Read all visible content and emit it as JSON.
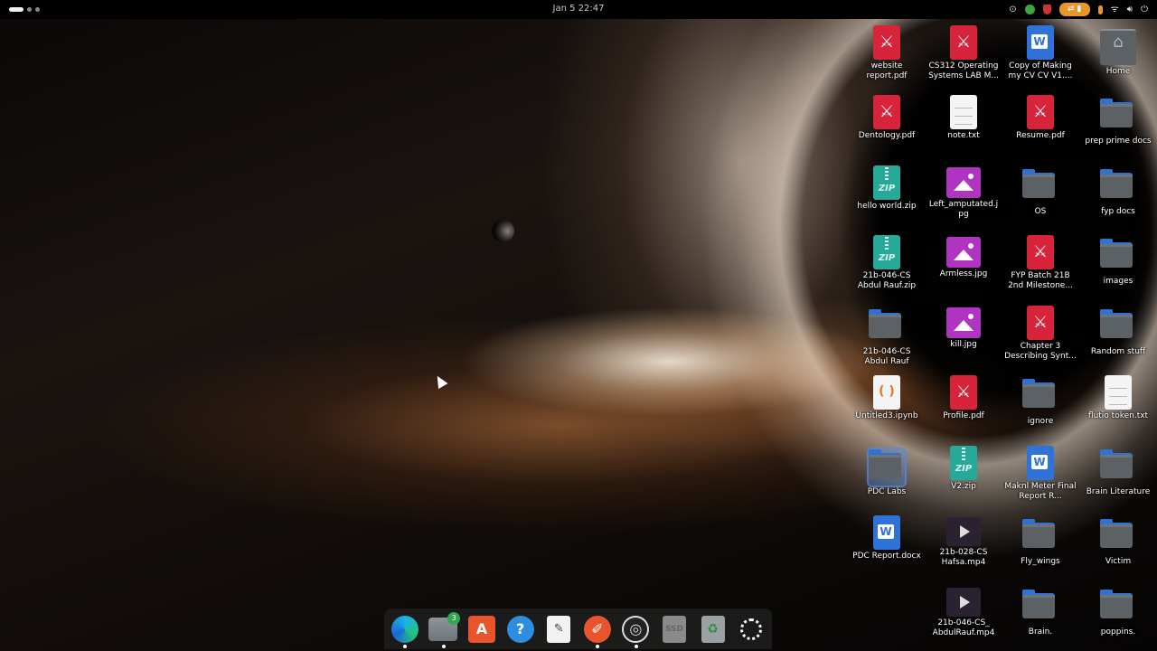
{
  "topbar": {
    "datetime": "Jan 5  22:47",
    "tray_orange_label": "⇄ ▮"
  },
  "colors": {
    "accent": "#e8962a",
    "folder_blue": "#2e72d2",
    "selected": "#508ce6"
  },
  "desktop": {
    "icons": [
      {
        "label": "website report.pdf",
        "type": "pdf"
      },
      {
        "label": "CS312 Operating Systems LAB M...",
        "type": "pdf"
      },
      {
        "label": "Copy of Making my CV  CV V1....",
        "type": "doc"
      },
      {
        "label": "Home",
        "type": "home"
      },
      {
        "label": "Dentology.pdf",
        "type": "pdf"
      },
      {
        "label": "note.txt",
        "type": "txt"
      },
      {
        "label": "Resume.pdf",
        "type": "pdf"
      },
      {
        "label": "prep prime docs",
        "type": "folder"
      },
      {
        "label": "hello world.zip",
        "type": "zip"
      },
      {
        "label": "Left_amputated.jpg",
        "type": "img"
      },
      {
        "label": "OS",
        "type": "folder"
      },
      {
        "label": "fyp docs",
        "type": "folder"
      },
      {
        "label": "21b-046-CS Abdul Rauf.zip",
        "type": "zip"
      },
      {
        "label": "Armless.jpg",
        "type": "img"
      },
      {
        "label": "FYP Batch 21B 2nd Milestone...",
        "type": "pdf"
      },
      {
        "label": "images",
        "type": "folder"
      },
      {
        "label": "21b-046-CS Abdul Rauf",
        "type": "folder"
      },
      {
        "label": "kill.jpg",
        "type": "img"
      },
      {
        "label": "Chapter 3 Describing Synt...",
        "type": "pdf"
      },
      {
        "label": "Random stuff",
        "type": "folder"
      },
      {
        "label": "Untitled3.ipynb",
        "type": "ipynb"
      },
      {
        "label": "Profile.pdf",
        "type": "pdf"
      },
      {
        "label": "ignore",
        "type": "folder"
      },
      {
        "label": "flutio token.txt",
        "type": "txt"
      },
      {
        "label": "PDC Labs",
        "type": "folder",
        "selected": true
      },
      {
        "label": "V2.zip",
        "type": "zip"
      },
      {
        "label": "Maknl Meter Final Report R...",
        "type": "doc"
      },
      {
        "label": "Brain Literature",
        "type": "folder"
      },
      {
        "label": "PDC Report.docx",
        "type": "doc"
      },
      {
        "label": "21b-028-CS Hafsa.mp4",
        "type": "video"
      },
      {
        "label": "Fly_wings",
        "type": "folder"
      },
      {
        "label": "Victim",
        "type": "folder"
      },
      {
        "label": "21b-046-CS_ AbdulRauf.mp4",
        "type": "video"
      },
      {
        "label": "Brain.",
        "type": "folder"
      },
      {
        "label": "poppins.",
        "type": "folder"
      }
    ]
  },
  "dock": {
    "items": [
      {
        "name": "edge-icon",
        "icon": "",
        "style": "edge",
        "running": true
      },
      {
        "name": "files-icon",
        "icon": "",
        "style": "files",
        "running": true,
        "badge": "3"
      },
      {
        "name": "app-store-icon",
        "icon": "A",
        "style": "store"
      },
      {
        "name": "help-icon",
        "icon": "?",
        "style": "help"
      },
      {
        "name": "text-editor-icon",
        "icon": "✎",
        "style": "editor"
      },
      {
        "name": "pen-app-icon",
        "icon": "✐",
        "style": "pen",
        "running": true
      },
      {
        "name": "obs-icon",
        "icon": "◎",
        "style": "obs",
        "running": true
      },
      {
        "name": "ssd-drive-icon",
        "icon": "SSD",
        "style": "ssd"
      },
      {
        "name": "trash-icon",
        "icon": "♻",
        "style": "trash"
      },
      {
        "name": "show-apps-icon",
        "icon": "",
        "style": "apps"
      }
    ]
  }
}
